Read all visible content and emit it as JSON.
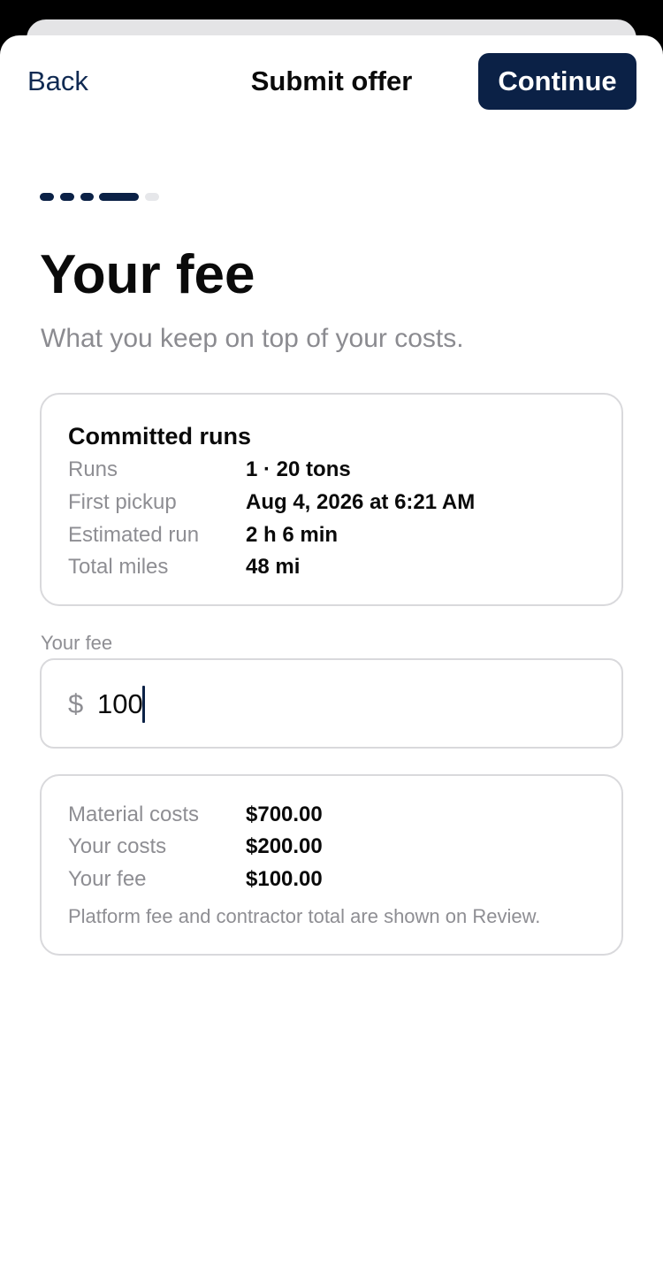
{
  "nav": {
    "back_label": "Back",
    "title": "Submit offer",
    "continue_label": "Continue"
  },
  "progress": {
    "total_steps": 5,
    "current_step": 4
  },
  "header": {
    "title": "Your fee",
    "subtitle": "What you keep on top of your costs."
  },
  "runs_card": {
    "heading": "Committed runs",
    "rows": [
      {
        "label": "Runs",
        "value": "1 · 20 tons"
      },
      {
        "label": "First pickup",
        "value": "Aug 4, 2026 at 6:21 AM"
      },
      {
        "label": "Estimated run",
        "value": "2 h 6 min"
      },
      {
        "label": "Total miles",
        "value": "48 mi"
      }
    ]
  },
  "fee_field": {
    "label": "Your fee",
    "currency_symbol": "$",
    "value": "100"
  },
  "costs_card": {
    "rows": [
      {
        "label": "Material costs",
        "value": "$700.00"
      },
      {
        "label": "Your costs",
        "value": "$200.00"
      },
      {
        "label": "Your fee",
        "value": "$100.00"
      }
    ],
    "footnote": "Platform fee and contractor total are shown on Review."
  },
  "colors": {
    "primary": "#0b2146",
    "muted_text": "#8e8e93",
    "border": "#d9d9dc",
    "progress_inactive": "#e6e7ea"
  }
}
